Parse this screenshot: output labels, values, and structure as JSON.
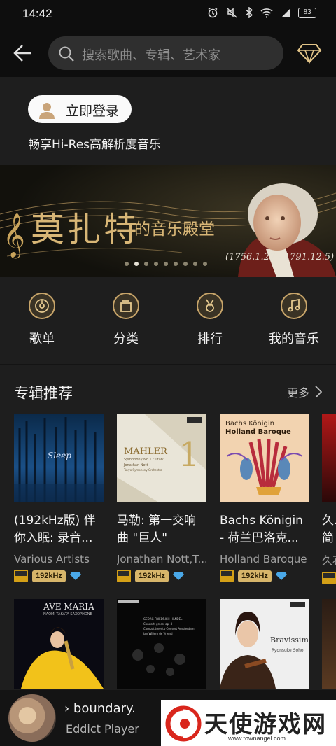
{
  "status_bar": {
    "time": "14:42",
    "battery": "83"
  },
  "header": {
    "search_placeholder": "搜索歌曲、专辑、艺术家"
  },
  "login": {
    "button_label": "立即登录",
    "subtitle": "畅享Hi-Res高解析度音乐"
  },
  "banner": {
    "title_main": "莫扎特",
    "title_suffix": "的音乐殿堂",
    "dates": "(1756.1.27 - 1791.12.5)",
    "page_count": 9,
    "active_page": 1
  },
  "nav": [
    {
      "label": "歌单",
      "icon": "disc-icon"
    },
    {
      "label": "分类",
      "icon": "category-icon"
    },
    {
      "label": "排行",
      "icon": "ranking-medal-icon"
    },
    {
      "label": "我的音乐",
      "icon": "music-note-icon"
    }
  ],
  "section": {
    "title": "专辑推荐",
    "more_label": "更多"
  },
  "albums": [
    {
      "title": "(192kHz版) 伴你入眠: 录音...",
      "artist": "Various Artists",
      "quality": "192kHz",
      "cover_text": "Sleep"
    },
    {
      "title": "马勒: 第一交响曲 \"巨人\"",
      "artist": "Jonathan Nott,T...",
      "quality": "192kHz",
      "cover_text": "MAHLER",
      "cover_sub": "Symphony No.1 \"Titan\"",
      "cover_sub2": "Jonathan Nott",
      "cover_sub3": "Tokyo Symphony Orchestra",
      "cover_num": "1"
    },
    {
      "title": "Bachs Königin - 荷兰巴洛克...",
      "artist": "Holland Baroque",
      "quality": "192kHz",
      "cover_text": "Bachs Königin",
      "cover_sub": "Holland Baroque"
    },
    {
      "title": "久...简",
      "artist": "久石",
      "quality": ""
    }
  ],
  "albums_row2": [
    {
      "cover_text": "AVE MARIA",
      "cover_sub": "NAOMI TAKATA SAXOPHONE"
    },
    {
      "cover_text": "GEORG FRIEDRICH HÄNDEL",
      "cover_sub": "Concerti grossi op. 3",
      "cover_sub2": "Combattimento Consort Amsterdam",
      "cover_sub3": "Jan Willem de Vriend"
    },
    {
      "cover_text": "Bravissimo",
      "cover_sub": "Ryonsuke Soho"
    },
    {
      "cover_text": ""
    }
  ],
  "mini_player": {
    "title": "› boundary.",
    "subtitle": "Eddict Player"
  },
  "watermark": {
    "text": "天使游戏网",
    "url": "www.townangel.com"
  }
}
